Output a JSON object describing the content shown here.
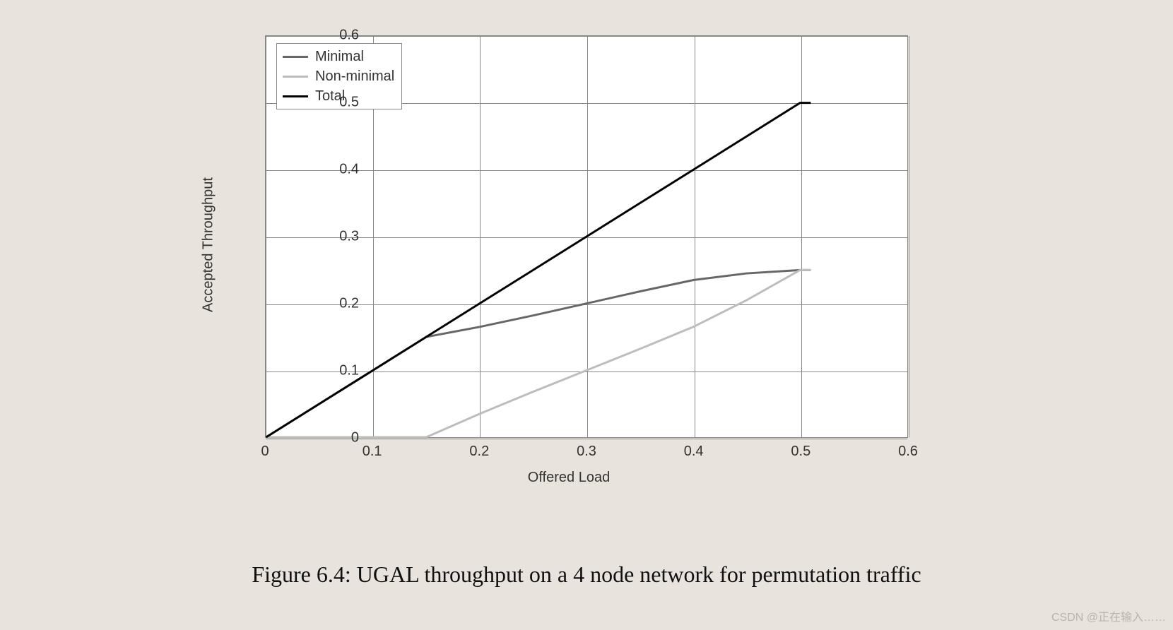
{
  "chart_data": {
    "type": "line",
    "xlabel": "Offered Load",
    "ylabel": "Accepted Throughput",
    "xlim": [
      0,
      0.6
    ],
    "ylim": [
      0,
      0.6
    ],
    "x": [
      0,
      0.05,
      0.1,
      0.15,
      0.2,
      0.25,
      0.3,
      0.35,
      0.4,
      0.45,
      0.5,
      0.51
    ],
    "series": [
      {
        "name": "Minimal",
        "color": "#676767",
        "values": [
          0,
          0.05,
          0.1,
          0.15,
          0.165,
          0.182,
          0.2,
          0.218,
          0.235,
          0.245,
          0.25,
          0.25
        ]
      },
      {
        "name": "Non-minimal",
        "color": "#bdbdbd",
        "values": [
          0,
          0,
          0,
          0,
          0.035,
          0.068,
          0.1,
          0.132,
          0.165,
          0.205,
          0.25,
          0.25
        ]
      },
      {
        "name": "Total",
        "color": "#000000",
        "values": [
          0,
          0.05,
          0.1,
          0.15,
          0.2,
          0.25,
          0.3,
          0.35,
          0.4,
          0.45,
          0.5,
          0.5
        ]
      }
    ],
    "xticks": [
      0,
      0.1,
      0.2,
      0.3,
      0.4,
      0.5,
      0.6
    ],
    "yticks": [
      0,
      0.1,
      0.2,
      0.3,
      0.4,
      0.5,
      0.6
    ],
    "legend_position": "upper-left",
    "grid": true
  },
  "caption": "Figure 6.4: UGAL throughput on a 4 node network for permutation traffic",
  "watermark": "CSDN @正在输入……"
}
